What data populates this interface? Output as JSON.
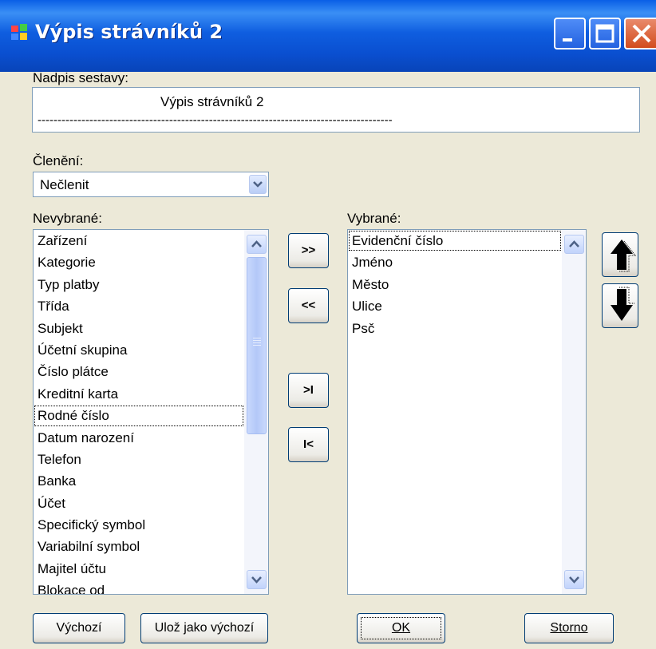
{
  "window": {
    "title": "Výpis strávníků 2",
    "colors": {
      "titlebar": "#0a4fd0",
      "client": "#ece9d8",
      "close": "#d24c1e"
    }
  },
  "caption_label": "Nadpis sestavy:",
  "caption_text": {
    "line1": "Výpis strávníků 2",
    "line2": "-----------------------------------------------------------------------------------------"
  },
  "grouping": {
    "label": "Členění:",
    "value": "Nečlenit"
  },
  "unselected": {
    "label": "Nevybrané:",
    "items": [
      "Zařízení",
      "Kategorie",
      "Typ platby",
      "Třída",
      "Subjekt",
      "Účetní skupina",
      "Číslo plátce",
      "Kreditní karta",
      "Rodné číslo",
      "Datum narození",
      "Telefon",
      "Banka",
      "Účet",
      "Specifický symbol",
      "Variabilní symbol",
      "Majitel účtu",
      "Blokace od"
    ],
    "focused_index": 8
  },
  "selected": {
    "label": "Vybrané:",
    "items": [
      "Evidenční číslo",
      "Jméno",
      "Město",
      "Ulice",
      "Psč"
    ],
    "focused_index": 0
  },
  "move_buttons": {
    "add": ">>",
    "remove": "<<",
    "add_all": ">I",
    "remove_all": "I<"
  },
  "order_buttons": {
    "up": "up-arrow-icon",
    "down": "down-arrow-icon"
  },
  "footer": {
    "default": "Výchozí",
    "save_default": "Ulož jako výchozí",
    "ok": "OK",
    "cancel": "Storno"
  }
}
